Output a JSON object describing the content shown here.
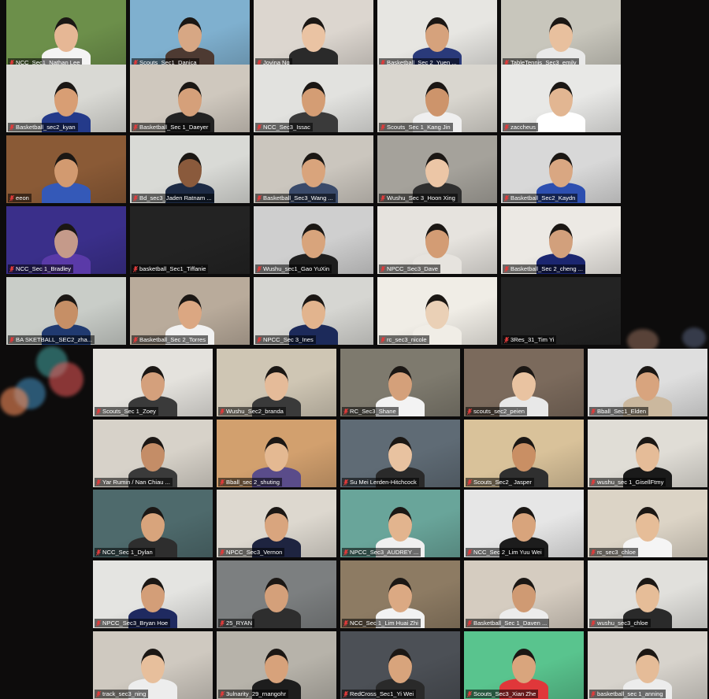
{
  "meeting": {
    "view": "gallery",
    "participants": [
      {
        "name": "NCC_Sec1_Nathan Lee",
        "bg": "#6c8f4a",
        "skin": "#e6b795",
        "shirt": "#f4f4f4",
        "muted": true
      },
      {
        "name": "Scouts_Sec1_Danica",
        "bg": "#7fb0cf",
        "skin": "#d7a784",
        "shirt": "#4d3a32",
        "muted": true
      },
      {
        "name": "Jovina Ng",
        "bg": "#dcd6cf",
        "skin": "#eac3a3",
        "shirt": "#2a2a2a",
        "muted": true
      },
      {
        "name": "Basketball_Sec 2_Yuen ...",
        "bg": "#e7e6e2",
        "skin": "#d6a27c",
        "shirt": "#2a3a7a",
        "muted": true
      },
      {
        "name": "TableTennis_Sec3_emily",
        "bg": "#c8c6bc",
        "skin": "#e8c09e",
        "shirt": "#e9e9e9",
        "muted": true
      },
      {
        "name": "Basketball_sec2_kyan",
        "bg": "#d9d9d4",
        "skin": "#d89e74",
        "shirt": "#243a8a",
        "muted": true
      },
      {
        "name": "Basketball_Sec 1_Daeyer",
        "bg": "#cfc8be",
        "skin": "#d5a07a",
        "shirt": "#222222",
        "muted": true
      },
      {
        "name": "NCC_Sec3_Issac",
        "bg": "#e2e2df",
        "skin": "#d49d74",
        "shirt": "#3a3a3a",
        "muted": true
      },
      {
        "name": "Scouts_Sec 1_Kang Jin",
        "bg": "#d9d6cf",
        "skin": "#cd946b",
        "shirt": "#efefef",
        "muted": true
      },
      {
        "name": "zaccheus",
        "bg": "#e8e8e6",
        "skin": "#e2b692",
        "shirt": "#ffffff",
        "muted": true
      },
      {
        "name": "eeon",
        "bg": "#8a5a36",
        "skin": "#d29a70",
        "shirt": "#3459b8",
        "muted": true
      },
      {
        "name": "Bd_sec3_Jaden Ratnam ...",
        "bg": "#d9dad6",
        "skin": "#8a5a3c",
        "shirt": "#1c2a44",
        "muted": true
      },
      {
        "name": "Basketball_Sec3_Wang ...",
        "bg": "#cbc6be",
        "skin": "#d9a47c",
        "shirt": "#3a4a6a",
        "muted": true
      },
      {
        "name": "Wushu_Sec 3_Hoon Xing",
        "bg": "#a5a29b",
        "skin": "#ecc6a6",
        "shirt": "#2f2f2f",
        "muted": true
      },
      {
        "name": "Basketball_Sec2_Kaydn",
        "bg": "#d8d8d8",
        "skin": "#d9a782",
        "shirt": "#2d4fb0",
        "muted": true
      },
      {
        "name": "NCC_Sec 1_Bradley",
        "bg": "#3a2f8a",
        "skin": "#c59a8a",
        "shirt": "#5a3aa8",
        "muted": true
      },
      {
        "name": "basketball_Sec1_Tiffanie",
        "bg": "#232323",
        "skin": "#232323",
        "shirt": "#232323",
        "muted": true
      },
      {
        "name": "Wushu_sec1_Gao YuXin",
        "bg": "#cfcfcf",
        "skin": "#d8a47c",
        "shirt": "#1e1e1e",
        "muted": true
      },
      {
        "name": "NPCC_Sec3_Dave",
        "bg": "#e6e3de",
        "skin": "#d39c74",
        "shirt": "#e6e3de",
        "muted": true
      },
      {
        "name": "Basketball_Sec 2_cheng ...",
        "bg": "#ece9e4",
        "skin": "#d2a07c",
        "shirt": "#1b2670",
        "muted": true
      },
      {
        "name": "BA SKETBALL_SEC2_zha...",
        "bg": "#c9cdc8",
        "skin": "#c68f66",
        "shirt": "#203a70",
        "muted": true
      },
      {
        "name": "Basketball_Sec 2_Torres",
        "bg": "#b9ab9b",
        "skin": "#dba782",
        "shirt": "#f1f1f1",
        "muted": true
      },
      {
        "name": "NPCC_Sec 3_Ines",
        "bg": "#d6d6d2",
        "skin": "#e2b48e",
        "shirt": "#1c2a5a",
        "muted": true
      },
      {
        "name": "rc_sec3_nicole",
        "bg": "#f0ede6",
        "skin": "#ead0b6",
        "shirt": "#f0ede6",
        "muted": true
      },
      {
        "name": "3Res_31_Tim Yi",
        "bg": "#232323",
        "skin": "#232323",
        "shirt": "#232323",
        "muted": true
      },
      {
        "name": "Scouts_Sec 1_Zoey",
        "bg": "#e4e2dd",
        "skin": "#d4a07c",
        "shirt": "#3a3a3a",
        "muted": true
      },
      {
        "name": "Wushu_Sec2_branda",
        "bg": "#cfc6b4",
        "skin": "#e5bb99",
        "shirt": "#3a3a3a",
        "muted": true
      },
      {
        "name": "RC_Sec3_Shane",
        "bg": "#7e7a6e",
        "skin": "#d4a07a",
        "shirt": "#f3f3f3",
        "muted": true
      },
      {
        "name": "scouts_sec2_peien",
        "bg": "#7b6a5c",
        "skin": "#e9c3a1",
        "shirt": "#e8e8e8",
        "muted": true
      },
      {
        "name": "Bball_Sec1_Elden",
        "bg": "#dedede",
        "skin": "#d8a47e",
        "shirt": "#cbb89e",
        "muted": true
      },
      {
        "name": "Yar Rumin / Nan Chiau ...",
        "bg": "#d7d2c9",
        "skin": "#c48d67",
        "shirt": "#3a3a3a",
        "muted": true
      },
      {
        "name": "Bball_sec 2_shuting",
        "bg": "#d2a06e",
        "skin": "#e4b992",
        "shirt": "#5a4c8a",
        "muted": true
      },
      {
        "name": "Su Mei Lerden-Hitchcock",
        "bg": "#5f6b75",
        "skin": "#e8c2a0",
        "shirt": "#2a2a2a",
        "muted": true
      },
      {
        "name": "Scouts_Sec2_ Jasper",
        "bg": "#d9c29a",
        "skin": "#c98f64",
        "shirt": "#2f2f2f",
        "muted": true
      },
      {
        "name": "wushu_sec 1_GisellFtmy",
        "bg": "#e0ddd6",
        "skin": "#e5bc98",
        "shirt": "#1a1a1a",
        "muted": true
      },
      {
        "name": "NCC_Sec 1_Dylan",
        "bg": "#4e6a6c",
        "skin": "#d8a47c",
        "shirt": "#2e2e2e",
        "muted": true
      },
      {
        "name": "NPCC_Sec3_Vernon",
        "bg": "#ddd8cf",
        "skin": "#d9a57e",
        "shirt": "#1e2440",
        "muted": true
      },
      {
        "name": "NPCC_Sec3_AUDREY ...",
        "bg": "#69a59a",
        "skin": "#e2b48e",
        "shirt": "#f0f0f0",
        "muted": true
      },
      {
        "name": "NCC_Sec 2_Lim Yuu Wei",
        "bg": "#e6e6e6",
        "skin": "#d8a47c",
        "shirt": "#1c1c1c",
        "muted": true
      },
      {
        "name": "rc_sec3_chloe",
        "bg": "#dcd4c6",
        "skin": "#e6bd98",
        "shirt": "#f5f5f5",
        "muted": true
      },
      {
        "name": "NPCC_Sec3_Bryan Hoe",
        "bg": "#e4e4e1",
        "skin": "#d39e78",
        "shirt": "#1f2a60",
        "muted": true
      },
      {
        "name": "25_RYAN",
        "bg": "#7c7f80",
        "skin": "#d4a07a",
        "shirt": "#2e2e2e",
        "muted": true
      },
      {
        "name": "NCC_Sec 1_Lim Huai Zhi",
        "bg": "#8d7b63",
        "skin": "#dba983",
        "shirt": "#f2f2f2",
        "muted": true
      },
      {
        "name": "Basketball_Sec 1_Daven ...",
        "bg": "#d5ccc0",
        "skin": "#cf9a73",
        "shirt": "#ececec",
        "muted": true
      },
      {
        "name": "wushu_sec3_chloe",
        "bg": "#e1e0dc",
        "skin": "#e6bd98",
        "shirt": "#2a2a2a",
        "muted": true
      },
      {
        "name": "track_sec3_ning",
        "bg": "#cfc9c0",
        "skin": "#e7bf9c",
        "shirt": "#ededed",
        "muted": true
      },
      {
        "name": "3ulnarity_29_rnangohr",
        "bg": "#b7b3aa",
        "skin": "#d7a27b",
        "shirt": "#1d1d1d",
        "muted": true
      },
      {
        "name": "RedCross_Sec1_Yi Wei",
        "bg": "#4c5056",
        "skin": "#d8a47c",
        "shirt": "#2a2a2a",
        "muted": true
      },
      {
        "name": "Scouts_Sec3_Xian Zhe",
        "bg": "#59c48e",
        "skin": "#d9a57d",
        "shirt": "#e0373a",
        "muted": true
      },
      {
        "name": "basketball_sec 1_anning",
        "bg": "#d7d3cc",
        "skin": "#e5bc98",
        "shirt": "#ececec",
        "muted": true
      }
    ]
  }
}
